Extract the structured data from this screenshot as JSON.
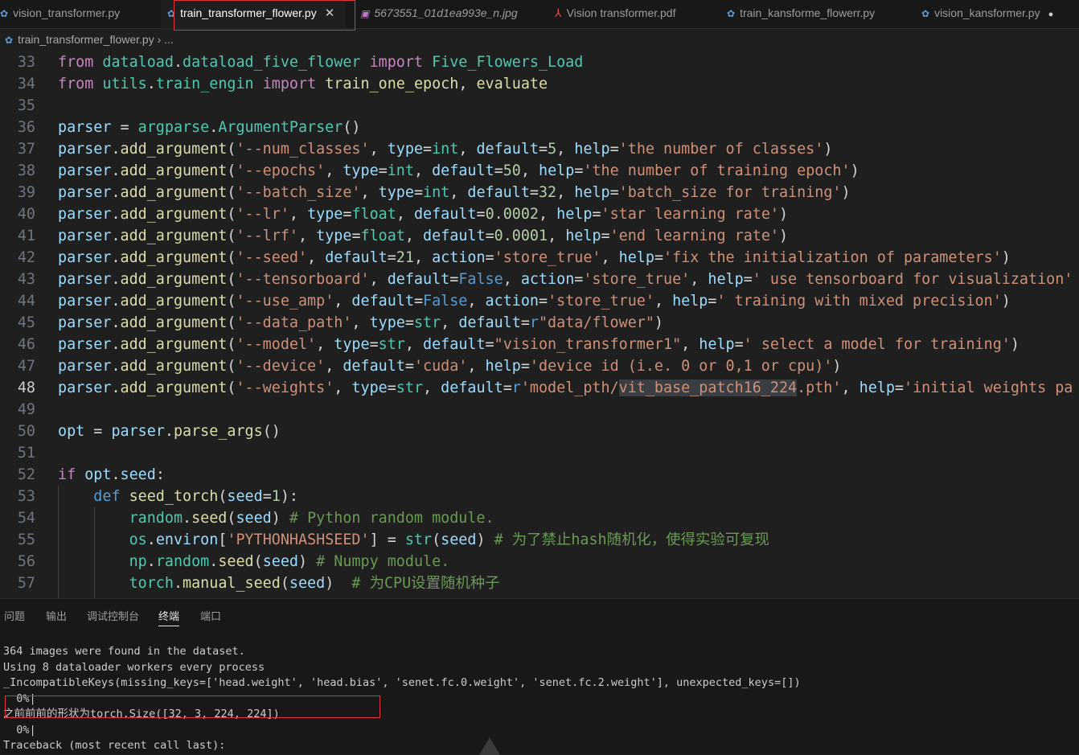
{
  "tabs": [
    {
      "label": "vision_transformer.py",
      "icon": "python-file-icon"
    },
    {
      "label": "train_transformer_flower.py",
      "icon": "python-file-icon",
      "active": true
    },
    {
      "label": "5673551_01d1ea993e_n.jpg",
      "icon": "image-file-icon"
    },
    {
      "label": "Vision transformer.pdf",
      "icon": "pdf-file-icon"
    },
    {
      "label": "train_kansforme_flowerr.py",
      "icon": "python-file-icon"
    },
    {
      "label": "vision_kansformer.py",
      "icon": "python-file-icon",
      "modified": true
    }
  ],
  "breadcrumb": {
    "file": "train_transformer_flower.py",
    "separator": "›",
    "more": "..."
  },
  "editor": {
    "current_line": 48,
    "lines": [
      {
        "n": "33",
        "t": "from dataload.dataload_five_flower import Five_Flowers_Load"
      },
      {
        "n": "34",
        "t": "from utils.train_engin import train_one_epoch, evaluate"
      },
      {
        "n": "35",
        "t": ""
      },
      {
        "n": "36",
        "t": "parser = argparse.ArgumentParser()"
      },
      {
        "n": "37",
        "t": "parser.add_argument('--num_classes', type=int, default=5, help='the number of classes')"
      },
      {
        "n": "38",
        "t": "parser.add_argument('--epochs', type=int, default=50, help='the number of training epoch')"
      },
      {
        "n": "39",
        "t": "parser.add_argument('--batch_size', type=int, default=32, help='batch_size for training')"
      },
      {
        "n": "40",
        "t": "parser.add_argument('--lr', type=float, default=0.0002, help='star learning rate')"
      },
      {
        "n": "41",
        "t": "parser.add_argument('--lrf', type=float, default=0.0001, help='end learning rate')"
      },
      {
        "n": "42",
        "t": "parser.add_argument('--seed', default=21, action='store_true', help='fix the initialization of parameters')"
      },
      {
        "n": "43",
        "t": "parser.add_argument('--tensorboard', default=False, action='store_true', help=' use tensorboard for visualization'"
      },
      {
        "n": "44",
        "t": "parser.add_argument('--use_amp', default=False, action='store_true', help=' training with mixed precision')"
      },
      {
        "n": "45",
        "t": "parser.add_argument('--data_path', type=str, default=r\"data/flower\")"
      },
      {
        "n": "46",
        "t": "parser.add_argument('--model', type=str, default=\"vision_transformer1\", help=' select a model for training')"
      },
      {
        "n": "47",
        "t": "parser.add_argument('--device', default='cuda', help='device id (i.e. 0 or 0,1 or cpu)')"
      },
      {
        "n": "48",
        "t": "parser.add_argument('--weights', type=str, default=r'model_pth/vit_base_patch16_224.pth', help='initial weights pa"
      },
      {
        "n": "49",
        "t": ""
      },
      {
        "n": "50",
        "t": "opt = parser.parse_args()"
      },
      {
        "n": "51",
        "t": ""
      },
      {
        "n": "52",
        "t": "if opt.seed:"
      },
      {
        "n": "53",
        "t": "    def seed_torch(seed=1):"
      },
      {
        "n": "54",
        "t": "        random.seed(seed) # Python random module."
      },
      {
        "n": "55",
        "t": "        os.environ['PYTHONHASHSEED'] = str(seed) # 为了禁止hash随机化，使得实验可复现"
      },
      {
        "n": "56",
        "t": "        np.random.seed(seed) # Numpy module."
      },
      {
        "n": "57",
        "t": "        torch.manual_seed(seed)  # 为CPU设置随机种子"
      }
    ]
  },
  "panel": {
    "tabs": [
      "问题",
      "输出",
      "调试控制台",
      "终端",
      "端口"
    ],
    "active_tab": "终端",
    "terminal_lines": [
      "364 images were found in the dataset.",
      "Using 8 dataloader workers every process",
      "_IncompatibleKeys(missing_keys=['head.weight', 'head.bias', 'senet.fc.0.weight', 'senet.fc.2.weight'], unexpected_keys=[])",
      "  0%|",
      "之前前前的形状为torch.Size([32, 3, 224, 224])",
      "  0%|",
      "Traceback (most recent call last):"
    ]
  },
  "colors": {
    "editor_bg": "#1f1f1f",
    "panel_bg": "#181818",
    "annotation_red": "#e0323b"
  }
}
